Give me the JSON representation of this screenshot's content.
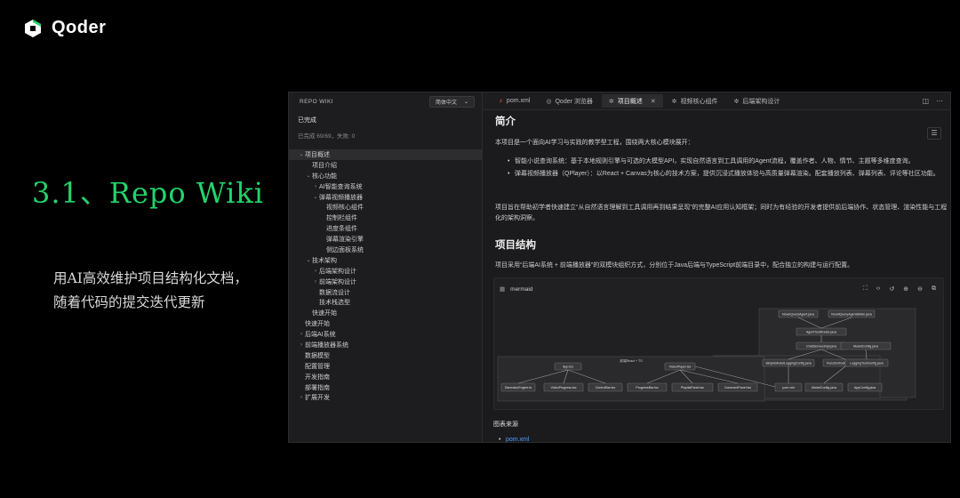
{
  "brand": {
    "name": "Qoder",
    "accent": "#23d36b"
  },
  "slide": {
    "title": "3.1、Repo Wiki",
    "desc_line1": "用AI高效维护项目结构化文档，",
    "desc_line2": "随着代码的提交迭代更新"
  },
  "sidebar": {
    "title": "REPO WIKI",
    "language": "简体中文",
    "status": "已完成",
    "progress": "已完成 69/69，失败: 0",
    "tree": [
      {
        "label": "项目概述",
        "depth": 0,
        "chevron": "down",
        "active": true
      },
      {
        "label": "项目介绍",
        "depth": 1,
        "chevron": ""
      },
      {
        "label": "核心功能",
        "depth": 1,
        "chevron": "down"
      },
      {
        "label": "AI智能查询系统",
        "depth": 2,
        "chevron": "right"
      },
      {
        "label": "弹幕视频播放器",
        "depth": 2,
        "chevron": "down"
      },
      {
        "label": "视频核心组件",
        "depth": 3,
        "chevron": ""
      },
      {
        "label": "控制栏组件",
        "depth": 3,
        "chevron": ""
      },
      {
        "label": "进度条组件",
        "depth": 3,
        "chevron": ""
      },
      {
        "label": "弹幕渲染引擎",
        "depth": 3,
        "chevron": ""
      },
      {
        "label": "侧边面板系统",
        "depth": 3,
        "chevron": ""
      },
      {
        "label": "技术架构",
        "depth": 1,
        "chevron": "down"
      },
      {
        "label": "后端架构设计",
        "depth": 2,
        "chevron": "right"
      },
      {
        "label": "前端架构设计",
        "depth": 2,
        "chevron": "right"
      },
      {
        "label": "数据流设计",
        "depth": 2,
        "chevron": ""
      },
      {
        "label": "技术栈选型",
        "depth": 2,
        "chevron": ""
      },
      {
        "label": "快速开始",
        "depth": 1,
        "chevron": ""
      },
      {
        "label": "快速开始",
        "depth": 0,
        "chevron": ""
      },
      {
        "label": "后端AI系统",
        "depth": 0,
        "chevron": "right"
      },
      {
        "label": "前端播放器系统",
        "depth": 0,
        "chevron": "right"
      },
      {
        "label": "数据模型",
        "depth": 0,
        "chevron": ""
      },
      {
        "label": "配置管理",
        "depth": 0,
        "chevron": ""
      },
      {
        "label": "开发指南",
        "depth": 0,
        "chevron": ""
      },
      {
        "label": "部署指南",
        "depth": 0,
        "chevron": ""
      },
      {
        "label": "扩展开发",
        "depth": 0,
        "chevron": "right"
      }
    ]
  },
  "tabs": [
    {
      "label": "pom.xml",
      "icon": "xml-file-icon",
      "glyph": "⚡",
      "active": false
    },
    {
      "label": "Qoder 浏览器",
      "icon": "browser-icon",
      "glyph": "◎",
      "active": false
    },
    {
      "label": "项目概述",
      "icon": "wiki-icon",
      "glyph": "✲",
      "active": true
    },
    {
      "label": "视频核心组件",
      "icon": "wiki-icon",
      "glyph": "✲",
      "active": false
    },
    {
      "label": "后端架构设计",
      "icon": "wiki-icon",
      "glyph": "✲",
      "active": false
    }
  ],
  "doc": {
    "h_intro": "简介",
    "intro_p": "本项目是一个面向AI学习与实践的教学型工程，围绕两大核心模块展开：",
    "bullet1": "智能小说查询系统：基于本地规则引擎与可选的大模型API，实现自然语言到工具调用的Agent流程，覆盖作者、人物、情节、主题等多维度查询。",
    "bullet2": "弹幕视频播放器（QPlayer）：以React + Canvas为核心的技术方案，提供沉浸式播放体验与高质量弹幕渲染。配套播放列表、弹幕列表、评论等社区功能。",
    "purpose_p": "项目旨在帮助初学者快速建立“从自然语言理解到工具调用再到结果呈现”的完整AI应用认知框架；同时为有经验的开发者提供前后端协作、状态管理、渲染性能与工程化的架构洞察。",
    "h_structure": "项目结构",
    "structure_p": "项目采用“后端AI系统 + 前端播放器”的双模块组织方式，分别位于Java后端与TypeScript前端目录中，配合独立的构建与运行配置。",
    "mermaid_label": "mermaid",
    "sources_title": "图表来源",
    "source_link": "pom.xml"
  },
  "diagram": {
    "group_right": "后端Java",
    "group_left": "前端React + TS",
    "group_center": "外部组件",
    "right_nodes": [
      "NovelQueryAgent.java",
      "NovelQueryAgentsMain.java",
      "AgentToolRouter.java",
      "ChatServiceImpl.java",
      "SimpleModelLoggingConfig.java",
      "FunctionToolsAdapter.java",
      "ModelConfig.java",
      "LoggingToolConfig.java"
    ],
    "bottom_right_nodes": [
      "pom.xml",
      "ModelConfig.java",
      "AppConfig.java"
    ],
    "left_nodes": [
      "App.tsx",
      "VideoPlayer.tsx",
      "DanmakuEngine.ts",
      "VideoProgress.tsx",
      "ControlBar.tsx",
      "ProgressBar.tsx",
      "PlaylistPanel.tsx",
      "CommentPanel.tsx"
    ]
  }
}
